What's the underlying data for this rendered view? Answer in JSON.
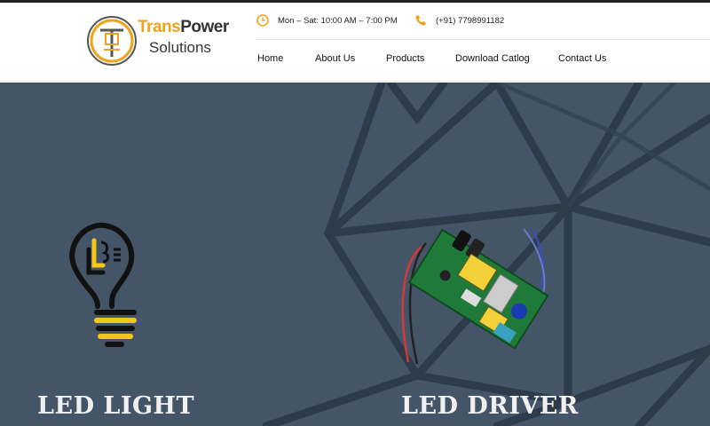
{
  "brand": {
    "name_part1": "Trans",
    "name_part2": "Power",
    "subtitle": "Solutions",
    "accent_color": "#f0a21a"
  },
  "contact": {
    "hours_icon": "clock-icon",
    "hours": "Mon – Sat: 10:00 AM – 7:00 PM",
    "phone_icon": "phone-icon",
    "phone": "(+91) 7798991182"
  },
  "nav": {
    "items": [
      {
        "label": "Home"
      },
      {
        "label": "About Us"
      },
      {
        "label": "Products"
      },
      {
        "label": "Download Catlog"
      },
      {
        "label": "Contact Us"
      }
    ]
  },
  "hero": {
    "background_color": "#445568",
    "left_product": {
      "title": "LED LIGHT",
      "icon": "led-bulb-icon"
    },
    "right_product": {
      "title": "LED DRIVER",
      "image": "led-driver-board-image"
    }
  }
}
